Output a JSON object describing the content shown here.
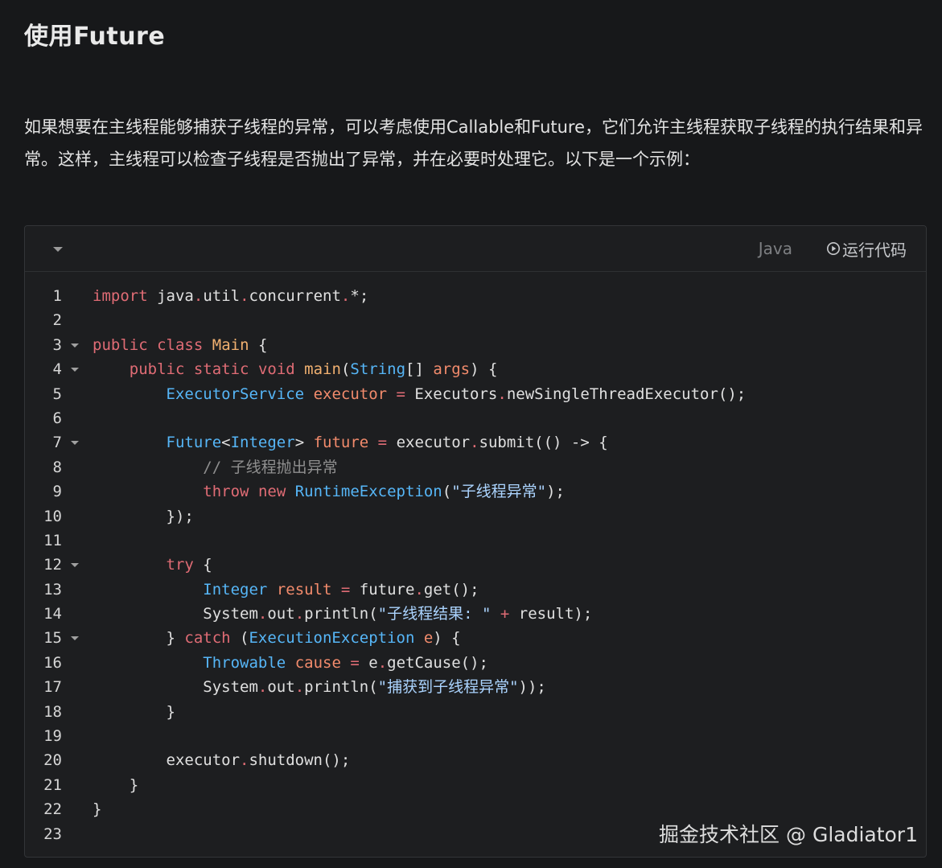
{
  "heading": "使用Future",
  "paragraph": "如果想要在主线程能够捕获子线程的异常，可以考虑使用Callable和Future，它们允许主线程获取子线程的执行结果和异常。这样，主线程可以检查子线程是否抛出了异常，并在必要时处理它。以下是一个示例：",
  "code_block": {
    "language": "Java",
    "run_label": "运行代码",
    "collapse_icon": "chevron-down-icon",
    "run_icon": "play-circle-icon",
    "lines": [
      {
        "n": "1",
        "fold": false,
        "tokens": [
          [
            "import",
            "kw"
          ],
          [
            " ",
            "def"
          ],
          [
            "java",
            "def"
          ],
          [
            ".",
            "dot"
          ],
          [
            "util",
            "def"
          ],
          [
            ".",
            "dot"
          ],
          [
            "concurrent",
            "def"
          ],
          [
            ".",
            "dot"
          ],
          [
            "*;",
            "def"
          ]
        ]
      },
      {
        "n": "2",
        "fold": false,
        "tokens": []
      },
      {
        "n": "3",
        "fold": true,
        "tokens": [
          [
            "public",
            "kw"
          ],
          [
            " ",
            "def"
          ],
          [
            "class",
            "kw"
          ],
          [
            " ",
            "def"
          ],
          [
            "Main",
            "fn"
          ],
          [
            " {",
            "def"
          ]
        ]
      },
      {
        "n": "4",
        "fold": true,
        "tokens": [
          [
            "    ",
            "def"
          ],
          [
            "public",
            "kw"
          ],
          [
            " ",
            "def"
          ],
          [
            "static",
            "kw"
          ],
          [
            " ",
            "def"
          ],
          [
            "void",
            "kw"
          ],
          [
            " ",
            "def"
          ],
          [
            "main",
            "fn"
          ],
          [
            "(",
            "def"
          ],
          [
            "String",
            "type"
          ],
          [
            "[] ",
            "def"
          ],
          [
            "args",
            "var"
          ],
          [
            ") {",
            "def"
          ]
        ]
      },
      {
        "n": "5",
        "fold": false,
        "tokens": [
          [
            "        ",
            "def"
          ],
          [
            "ExecutorService",
            "type"
          ],
          [
            " ",
            "def"
          ],
          [
            "executor",
            "var"
          ],
          [
            " ",
            "def"
          ],
          [
            "=",
            "kw"
          ],
          [
            " Executors",
            "def"
          ],
          [
            ".",
            "dot"
          ],
          [
            "newSingleThreadExecutor();",
            "def"
          ]
        ]
      },
      {
        "n": "6",
        "fold": false,
        "tokens": []
      },
      {
        "n": "7",
        "fold": true,
        "tokens": [
          [
            "        ",
            "def"
          ],
          [
            "Future",
            "type"
          ],
          [
            "<",
            "def"
          ],
          [
            "Integer",
            "type"
          ],
          [
            "> ",
            "def"
          ],
          [
            "future",
            "var"
          ],
          [
            " ",
            "def"
          ],
          [
            "=",
            "kw"
          ],
          [
            " executor",
            "def"
          ],
          [
            ".",
            "dot"
          ],
          [
            "submit(() -> {",
            "def"
          ]
        ]
      },
      {
        "n": "8",
        "fold": false,
        "tokens": [
          [
            "            ",
            "def"
          ],
          [
            "// 子线程抛出异常",
            "com"
          ]
        ]
      },
      {
        "n": "9",
        "fold": false,
        "tokens": [
          [
            "            ",
            "def"
          ],
          [
            "throw",
            "kw"
          ],
          [
            " ",
            "def"
          ],
          [
            "new",
            "kw"
          ],
          [
            " ",
            "def"
          ],
          [
            "RuntimeException",
            "type"
          ],
          [
            "(",
            "def"
          ],
          [
            "\"子线程异常\"",
            "str"
          ],
          [
            ");",
            "def"
          ]
        ]
      },
      {
        "n": "10",
        "fold": false,
        "tokens": [
          [
            "        });",
            "def"
          ]
        ]
      },
      {
        "n": "11",
        "fold": false,
        "tokens": []
      },
      {
        "n": "12",
        "fold": true,
        "tokens": [
          [
            "        ",
            "def"
          ],
          [
            "try",
            "kw"
          ],
          [
            " {",
            "def"
          ]
        ]
      },
      {
        "n": "13",
        "fold": false,
        "tokens": [
          [
            "            ",
            "def"
          ],
          [
            "Integer",
            "type"
          ],
          [
            " ",
            "def"
          ],
          [
            "result",
            "var"
          ],
          [
            " ",
            "def"
          ],
          [
            "=",
            "kw"
          ],
          [
            " future",
            "def"
          ],
          [
            ".",
            "dot"
          ],
          [
            "get();",
            "def"
          ]
        ]
      },
      {
        "n": "14",
        "fold": false,
        "tokens": [
          [
            "            System",
            "def"
          ],
          [
            ".",
            "dot"
          ],
          [
            "out",
            "def"
          ],
          [
            ".",
            "dot"
          ],
          [
            "println(",
            "def"
          ],
          [
            "\"子线程结果: \"",
            "str"
          ],
          [
            " ",
            "def"
          ],
          [
            "+",
            "kw"
          ],
          [
            " result);",
            "def"
          ]
        ]
      },
      {
        "n": "15",
        "fold": true,
        "tokens": [
          [
            "        } ",
            "def"
          ],
          [
            "catch",
            "kw"
          ],
          [
            " (",
            "def"
          ],
          [
            "ExecutionException",
            "type"
          ],
          [
            " ",
            "def"
          ],
          [
            "e",
            "var"
          ],
          [
            ") {",
            "def"
          ]
        ]
      },
      {
        "n": "16",
        "fold": false,
        "tokens": [
          [
            "            ",
            "def"
          ],
          [
            "Throwable",
            "type"
          ],
          [
            " ",
            "def"
          ],
          [
            "cause",
            "var"
          ],
          [
            " ",
            "def"
          ],
          [
            "=",
            "kw"
          ],
          [
            " e",
            "def"
          ],
          [
            ".",
            "dot"
          ],
          [
            "getCause();",
            "def"
          ]
        ]
      },
      {
        "n": "17",
        "fold": false,
        "tokens": [
          [
            "            System",
            "def"
          ],
          [
            ".",
            "dot"
          ],
          [
            "out",
            "def"
          ],
          [
            ".",
            "dot"
          ],
          [
            "println(",
            "def"
          ],
          [
            "\"捕获到子线程异常\"",
            "str"
          ],
          [
            "));",
            "def"
          ]
        ]
      },
      {
        "n": "18",
        "fold": false,
        "tokens": [
          [
            "        }",
            "def"
          ]
        ]
      },
      {
        "n": "19",
        "fold": false,
        "tokens": []
      },
      {
        "n": "20",
        "fold": false,
        "tokens": [
          [
            "        executor",
            "def"
          ],
          [
            ".",
            "dot"
          ],
          [
            "shutdown();",
            "def"
          ]
        ]
      },
      {
        "n": "21",
        "fold": false,
        "tokens": [
          [
            "    }",
            "def"
          ]
        ]
      },
      {
        "n": "22",
        "fold": false,
        "tokens": [
          [
            "}",
            "def"
          ]
        ]
      },
      {
        "n": "23",
        "fold": false,
        "tokens": []
      }
    ]
  },
  "watermark": "掘金技术社区 @ Gladiator1",
  "colors": {
    "background": "#17181a",
    "code_background": "#1d1e20",
    "keyword": "#e06c75",
    "type": "#56b6f7",
    "function": "#f0b070",
    "variable": "#f28b6c",
    "string": "#abd4ff",
    "comment": "#8f8f8f"
  }
}
